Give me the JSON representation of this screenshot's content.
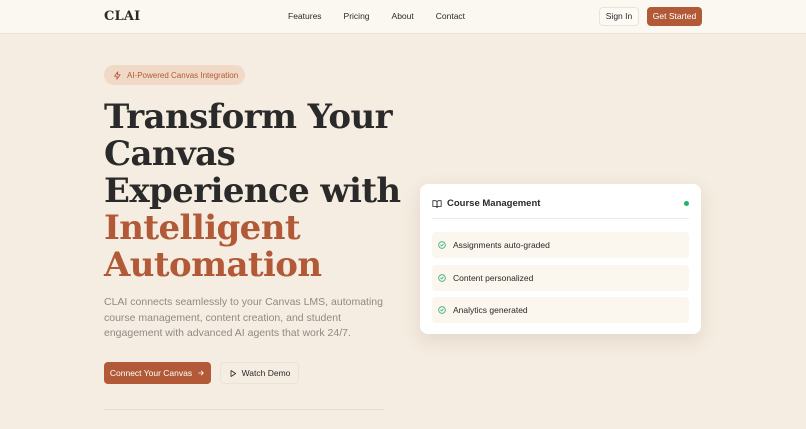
{
  "nav": {
    "logo": "CLAI",
    "links": [
      "Features",
      "Pricing",
      "About",
      "Contact"
    ],
    "sign_in": "Sign In",
    "get_started": "Get Started"
  },
  "hero": {
    "badge": "AI-Powered Canvas Integration",
    "headline_line1": "Transform Your",
    "headline_line2": "Canvas",
    "headline_line3": "Experience with",
    "headline_accent1": "Intelligent",
    "headline_accent2": "Automation",
    "description": "CLAI connects seamlessly to your Canvas LMS, automating course management, content creation, and student engagement with advanced AI agents that work 24/7.",
    "primary_cta": "Connect Your Canvas",
    "secondary_cta": "Watch Demo"
  },
  "card": {
    "title": "Course Management",
    "status_color": "#22b06b",
    "items": [
      "Assignments auto-graded",
      "Content personalized",
      "Analytics generated"
    ]
  },
  "colors": {
    "accent": "#b25a37",
    "background": "#f5ede1"
  },
  "icons": {
    "badge": "lightning-icon",
    "primary_cta": "arrow-right-icon",
    "secondary_cta": "play-icon",
    "card": "book-open-icon",
    "items": "check-circle-icon"
  }
}
